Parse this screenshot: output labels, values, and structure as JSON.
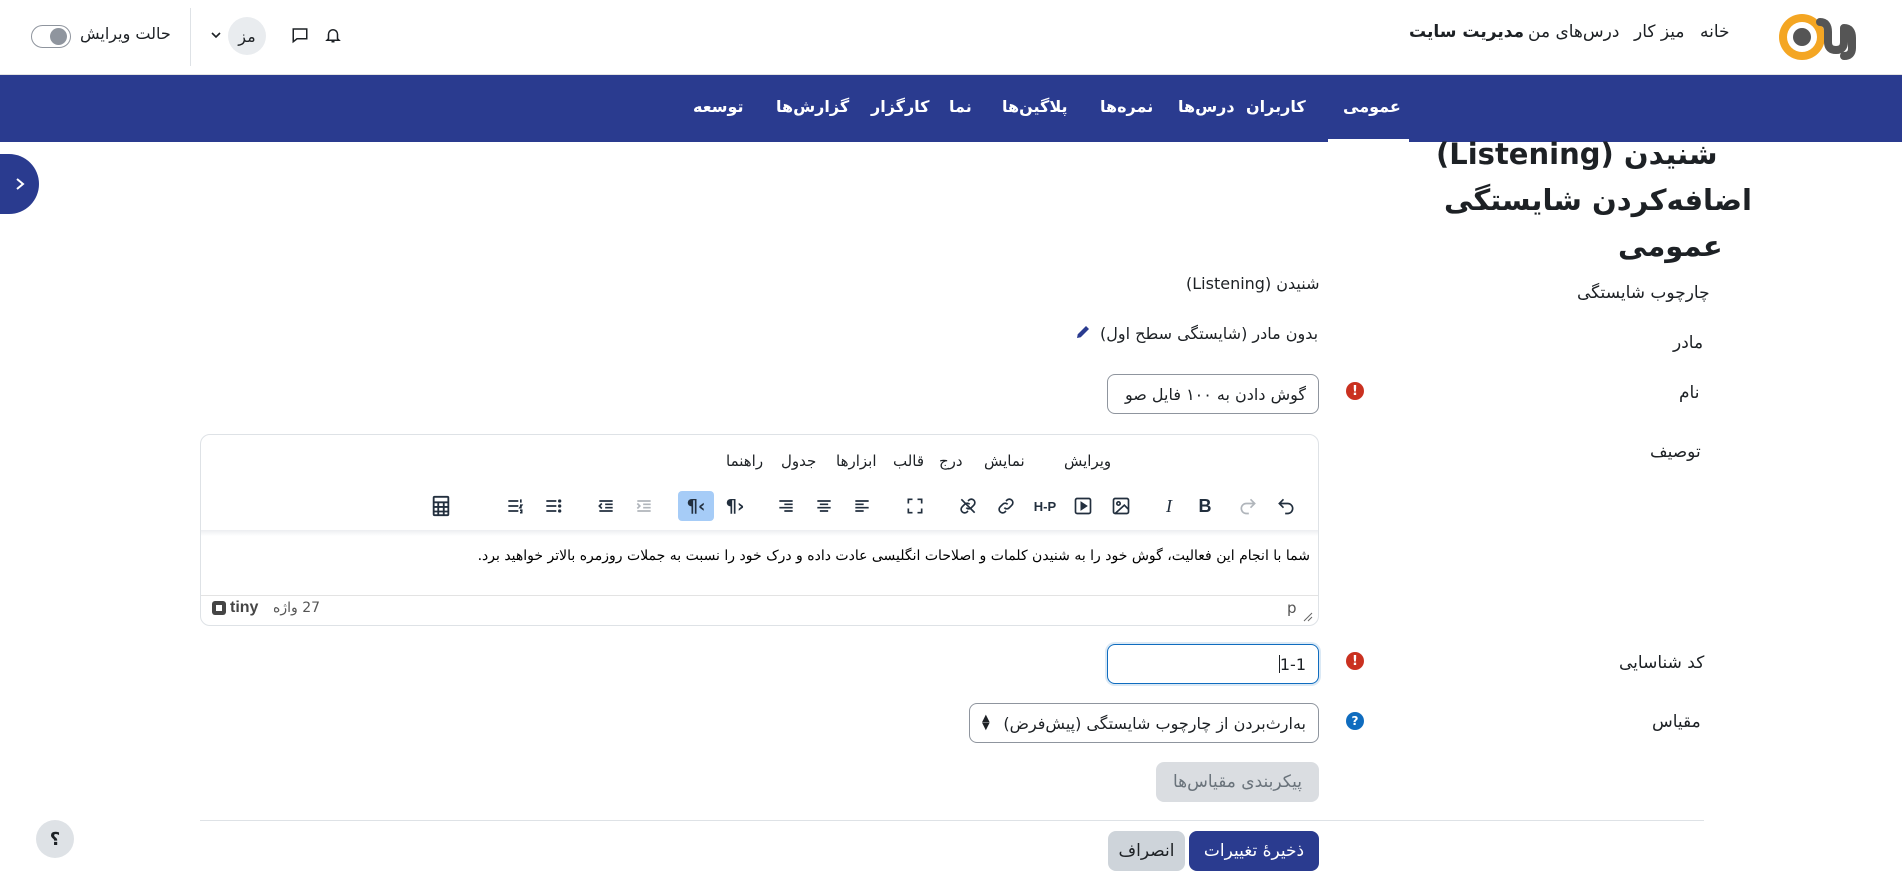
{
  "header": {
    "nav": [
      "خانه",
      "میز کار",
      "درس‌های من",
      "مدیریت سایت"
    ],
    "user_initials": "مز",
    "edit_mode_label": "حالت ویرایش"
  },
  "navbar": {
    "items": [
      "عمومی",
      "کاربران",
      "درس‌ها",
      "نمره‌ها",
      "پلاگین‌ها",
      "نما",
      "کارگزار",
      "گزارش‌ها",
      "توسعه"
    ],
    "active_index": 0
  },
  "page": {
    "heading1": "شنیدن (Listening)",
    "heading2": "اضافه‌کردن شایستگی",
    "heading3": "عمومی"
  },
  "form": {
    "framework_label": "چارچوب شایستگی",
    "framework_value": "شنیدن (Listening)",
    "parent_label": "مادر",
    "parent_value": "بدون مادر (شایستگی سطح اول)",
    "name_label": "نام",
    "name_value": "گوش دادن به ۱۰۰ فایل صو",
    "description_label": "توصیف",
    "idnumber_label": "کد شناسایی",
    "idnumber_value": "1-1",
    "scale_label": "مقیاس",
    "scale_value": "به‌ارث‌بردن از چارچوب شایستگی (پیش‌فرض)",
    "scale_config_button": "پیکربندی مقیاس‌ها",
    "save_button": "ذخیرهٔ تغییرات",
    "cancel_button": "انصراف"
  },
  "editor": {
    "menu": [
      "ویرایش",
      "نمایش",
      "درج",
      "قالب",
      "ابزارها",
      "جدول",
      "راهنما"
    ],
    "content": "شما با انجام این فعالیت، گوش خود را به شنیدن کلمات و اصلاحات انگلیسی عادت داده و درک خود را نسبت به جملات روزمره بالاتر خواهید برد.",
    "path": "p",
    "word_count": "27 واژه",
    "brand": "tiny"
  },
  "icons": {
    "bell": "bell-icon",
    "chat": "chat-icon",
    "help": "question-icon"
  },
  "colors": {
    "brand": "#2a3b8f",
    "required": "#ca3120",
    "info": "#0f6cbf"
  }
}
